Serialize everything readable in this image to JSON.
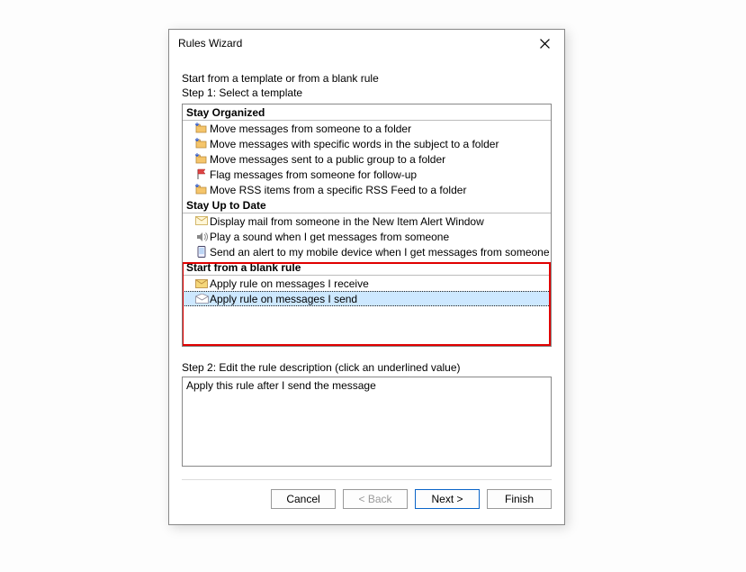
{
  "dialog": {
    "title": "Rules Wizard",
    "intro_line": "Start from a template or from a blank rule",
    "step1_label": "Step 1: Select a template",
    "groups": {
      "stay_organized": {
        "header": "Stay Organized",
        "items": [
          "Move messages from someone to a folder",
          "Move messages with specific words in the subject to a folder",
          "Move messages sent to a public group to a folder",
          "Flag messages from someone for follow-up",
          "Move RSS items from a specific RSS Feed to a folder"
        ]
      },
      "stay_up_to_date": {
        "header": "Stay Up to Date",
        "items": [
          "Display mail from someone in the New Item Alert Window",
          "Play a sound when I get messages from someone",
          "Send an alert to my mobile device when I get messages from someone"
        ]
      },
      "start_blank": {
        "header": "Start from a blank rule",
        "items": [
          "Apply rule on messages I receive",
          "Apply rule on messages I send"
        ]
      }
    },
    "step2_label": "Step 2: Edit the rule description (click an underlined value)",
    "rule_description": "Apply this rule after I send the message",
    "buttons": {
      "cancel": "Cancel",
      "back": "< Back",
      "next": "Next >",
      "finish": "Finish"
    }
  }
}
